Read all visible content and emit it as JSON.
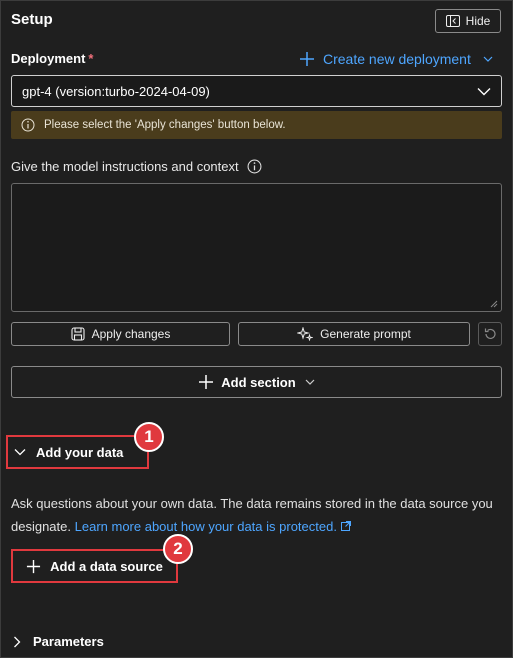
{
  "header": {
    "title": "Setup",
    "hide_label": "Hide"
  },
  "deployment": {
    "label": "Deployment",
    "required_mark": "*",
    "create_label": "Create new deployment",
    "selected": "gpt-4 (version:turbo-2024-04-09)",
    "warning": "Please select the 'Apply changes' button below."
  },
  "instructions": {
    "label": "Give the model instructions and context",
    "value": ""
  },
  "actions": {
    "apply_label": "Apply changes",
    "generate_label": "Generate prompt",
    "add_section_label": "Add section"
  },
  "data_section": {
    "toggle_label": "Add your data",
    "description": "Ask questions about your own data. The data remains stored in the data source you designate.",
    "learn_more": "Learn more about how your data is protected.",
    "add_source_label": "Add a data source"
  },
  "annotations": {
    "badge_1": "1",
    "badge_2": "2",
    "highlight_color": "#e0393e"
  },
  "parameters": {
    "label": "Parameters"
  },
  "colors": {
    "background": "#1f1f1f",
    "accent": "#4ea6ff",
    "warning_bg": "#4a3c1c"
  }
}
